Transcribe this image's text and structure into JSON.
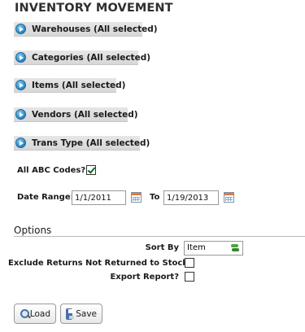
{
  "page": {
    "title": "INVENTORY MOVEMENT"
  },
  "filters": [
    {
      "label": "Warehouses (All selected)"
    },
    {
      "label": "Categories (All selected)"
    },
    {
      "label": "Items (All selected)"
    },
    {
      "label": "Vendors (All selected)"
    },
    {
      "label": "Trans Type (All selected)"
    }
  ],
  "abc_codes": {
    "label": "All ABC Codes?",
    "checked": true
  },
  "date_range": {
    "label": "Date Range:",
    "from_value": "1/1/2011",
    "to_label": "To",
    "to_value": "1/19/2013"
  },
  "options": {
    "title": "Options",
    "sort_by_label": "Sort By",
    "sort_by_value": "Item",
    "exclude_returns_label": "Exclude Returns Not Returned to Stock?",
    "exclude_returns_checked": false,
    "export_report_label": "Export Report?",
    "export_report_checked": false
  },
  "buttons": {
    "load": "Load",
    "save": "Save"
  },
  "colors": {
    "expand_icon": "#2b86c5",
    "filter_bar": "#dcdcdc",
    "check": "#0a6a1c"
  }
}
